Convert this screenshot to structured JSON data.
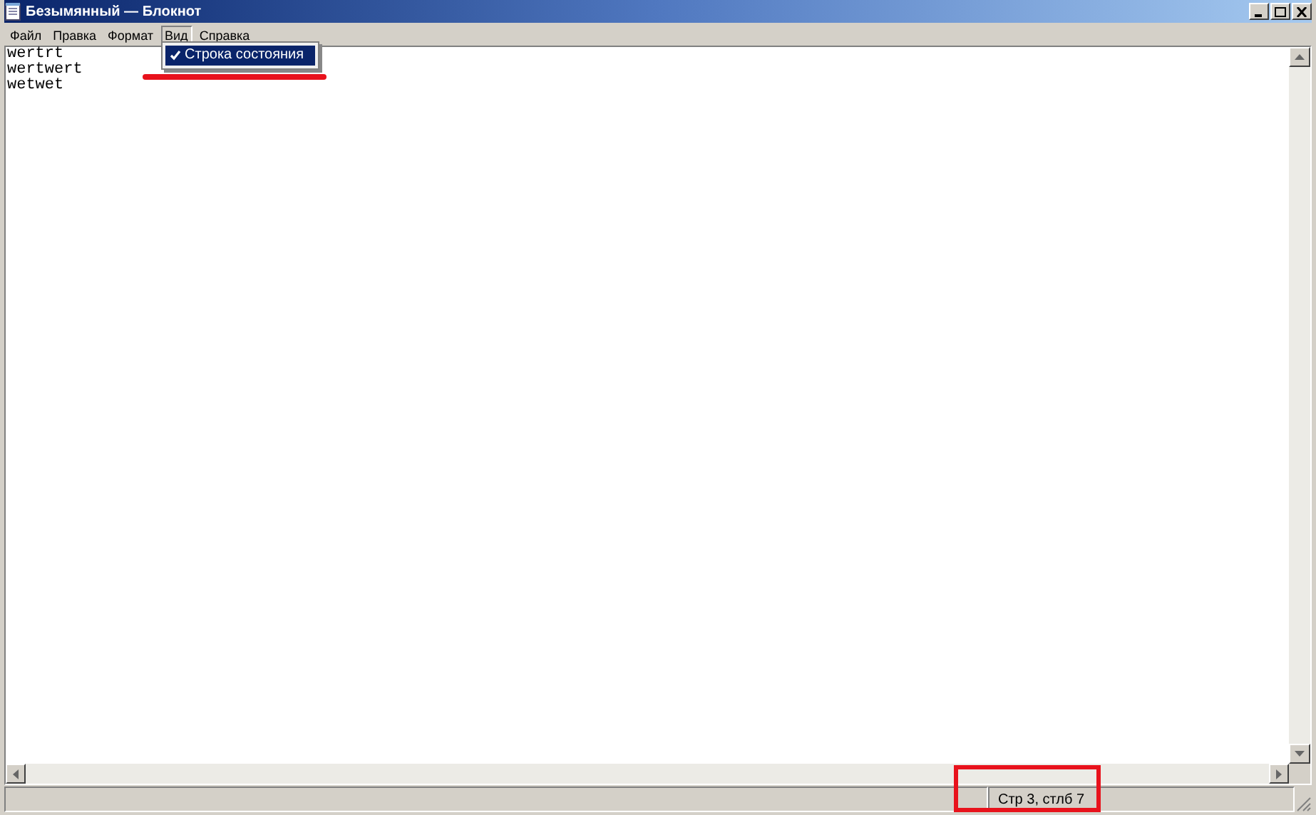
{
  "window": {
    "title": "Безымянный — Блокнот"
  },
  "menu": [
    {
      "label": "Файл",
      "open": false
    },
    {
      "label": "Правка",
      "open": false
    },
    {
      "label": "Формат",
      "open": false
    },
    {
      "label": "Вид",
      "open": true
    },
    {
      "label": "Справка",
      "open": false
    }
  ],
  "dropdown": {
    "items": [
      {
        "label": "Строка состояния",
        "checked": true,
        "selected": true
      }
    ]
  },
  "editor": {
    "lines": [
      "wertrt",
      "wertwert",
      "wetwet"
    ]
  },
  "status_bar": {
    "position": "Стр 3, стлб 7"
  }
}
